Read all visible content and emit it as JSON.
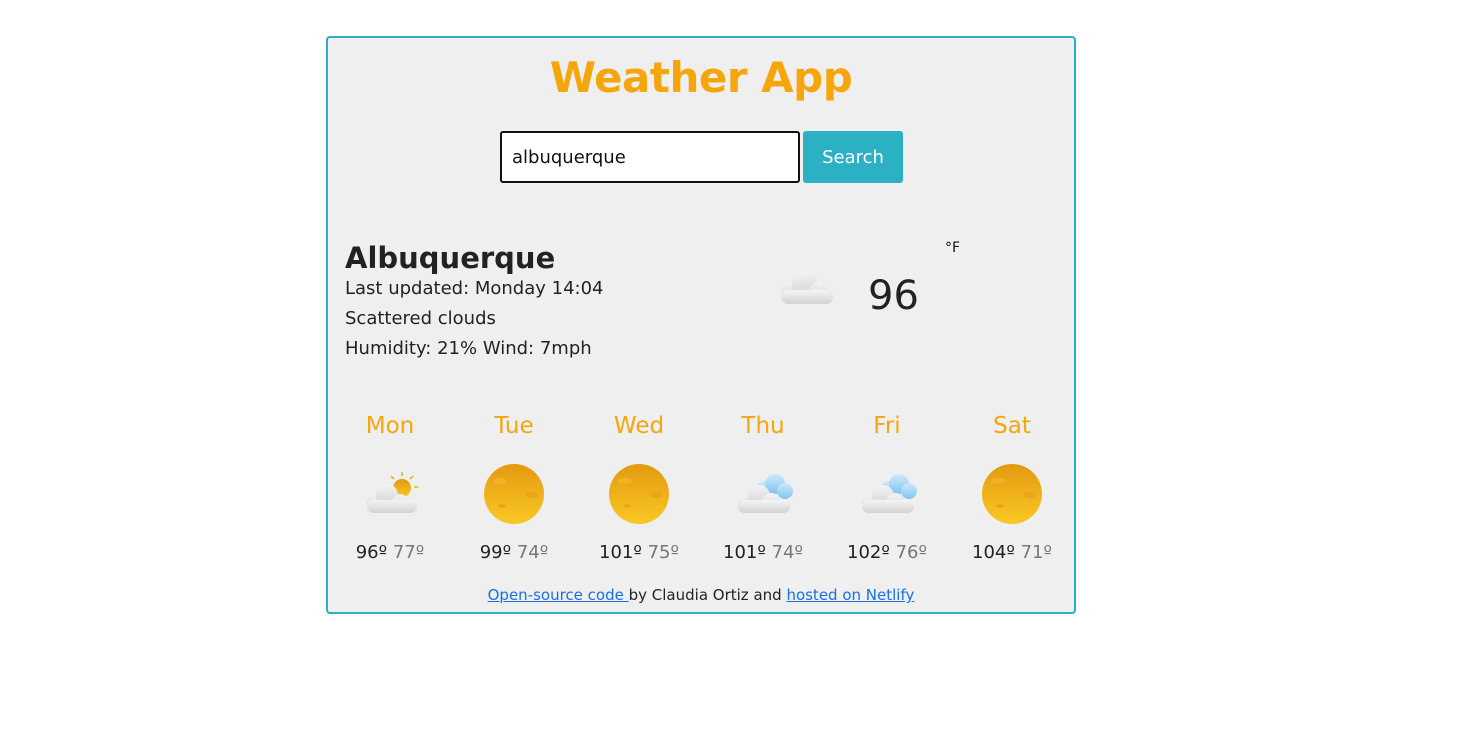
{
  "app": {
    "title": "Weather App"
  },
  "search": {
    "value": "albuquerque",
    "placeholder": "",
    "button_label": "Search"
  },
  "current": {
    "city": "Albuquerque",
    "last_updated": "Last updated: Monday 14:04",
    "description": "Scattered clouds",
    "humidity_wind": "Humidity: 21% Wind: 7mph",
    "icon": "scattered-clouds-icon",
    "temperature": "96",
    "unit": "°F"
  },
  "forecast": [
    {
      "day": "Mon",
      "high": "96º",
      "low": "77º",
      "icon": "partly-sunny-icon"
    },
    {
      "day": "Tue",
      "high": "99º",
      "low": "74º",
      "icon": "sun-icon"
    },
    {
      "day": "Wed",
      "high": "101º",
      "low": "75º",
      "icon": "sun-icon"
    },
    {
      "day": "Thu",
      "high": "101º",
      "low": "74º",
      "icon": "clouds-icon"
    },
    {
      "day": "Fri",
      "high": "102º",
      "low": "76º",
      "icon": "clouds-icon"
    },
    {
      "day": "Sat",
      "high": "104º",
      "low": "71º",
      "icon": "sun-icon"
    }
  ],
  "footer": {
    "link1_text": "Open-source code ",
    "middle_text": " by Claudia Ortiz and ",
    "link2_text": "hosted on Netlify"
  },
  "colors": {
    "accent": "#f5a60c",
    "button": "#2bb0c4",
    "card_border": "#2bb0c4",
    "card_background": "#efefef",
    "link": "#1a6fe8"
  }
}
